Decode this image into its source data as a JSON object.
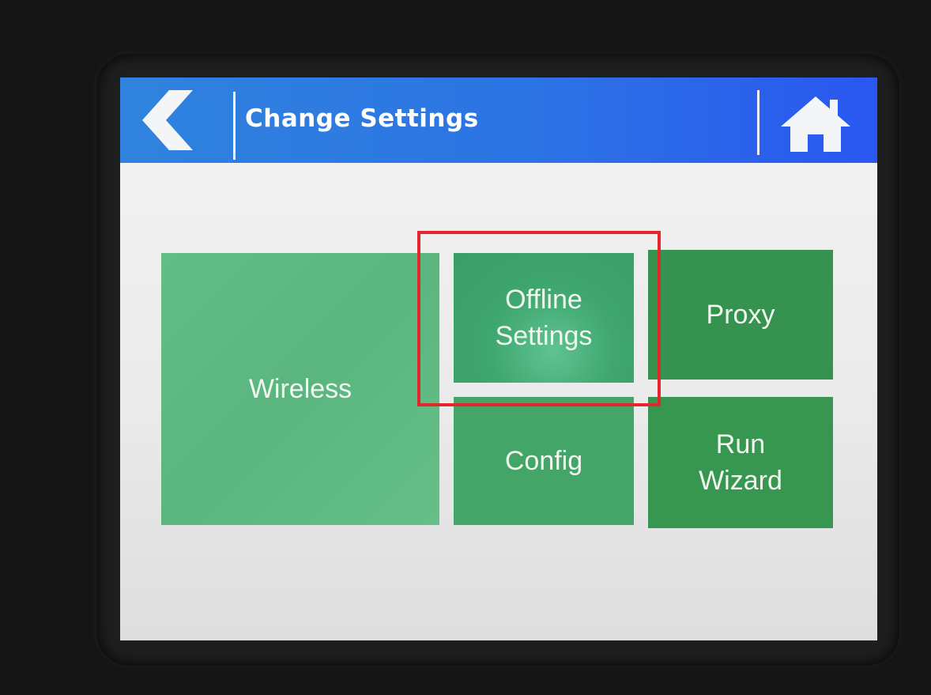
{
  "header": {
    "title": "Change Settings",
    "back_icon": "chevron-left-icon",
    "home_icon": "home-icon"
  },
  "tiles": {
    "wireless": "Wireless",
    "offline_settings": "Offline\nSettings",
    "proxy": "Proxy",
    "config": "Config",
    "run_wizard": "Run\nWizard"
  },
  "colors": {
    "header_blue": "#2c73e4",
    "tile_light_green": "#5ab67e",
    "tile_dark_green": "#35934f",
    "highlight_red": "#e3262b"
  }
}
